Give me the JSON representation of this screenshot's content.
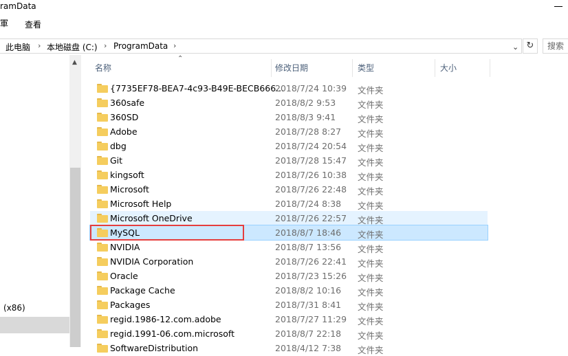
{
  "window": {
    "title": "ramData"
  },
  "ribbon": {
    "edge_label": "軍",
    "view_tab": "查看"
  },
  "address": {
    "crumbs": [
      "此电脑",
      "本地磁盘 (C:)",
      "ProgramData"
    ],
    "separator": "›",
    "dropdown": "⌄",
    "refresh": "↻",
    "search_placeholder": "搜索"
  },
  "nav": {
    "partial_item": "(x86)"
  },
  "columns": {
    "name": "名称",
    "modified": "修改日期",
    "type": "类型",
    "size": "大小",
    "sort_indicator": "⌃"
  },
  "files": [
    {
      "name": "{7735EF78-BEA7-4c93-B49E-BECB666...",
      "date": "2018/7/24 10:39",
      "type": "文件夹"
    },
    {
      "name": "360safe",
      "date": "2018/8/2 9:53",
      "type": "文件夹"
    },
    {
      "name": "360SD",
      "date": "2018/8/3 9:41",
      "type": "文件夹"
    },
    {
      "name": "Adobe",
      "date": "2018/7/28 8:27",
      "type": "文件夹"
    },
    {
      "name": "dbg",
      "date": "2018/7/24 20:54",
      "type": "文件夹"
    },
    {
      "name": "Git",
      "date": "2018/7/28 15:47",
      "type": "文件夹"
    },
    {
      "name": "kingsoft",
      "date": "2018/7/26 10:38",
      "type": "文件夹"
    },
    {
      "name": "Microsoft",
      "date": "2018/7/26 22:48",
      "type": "文件夹"
    },
    {
      "name": "Microsoft Help",
      "date": "2018/7/24 8:38",
      "type": "文件夹"
    },
    {
      "name": "Microsoft OneDrive",
      "date": "2018/7/26 22:57",
      "type": "文件夹"
    },
    {
      "name": "MySQL",
      "date": "2018/8/7 18:46",
      "type": "文件夹"
    },
    {
      "name": "NVIDIA",
      "date": "2018/8/7 13:56",
      "type": "文件夹"
    },
    {
      "name": "NVIDIA Corporation",
      "date": "2018/7/26 22:41",
      "type": "文件夹"
    },
    {
      "name": "Oracle",
      "date": "2018/7/23 15:26",
      "type": "文件夹"
    },
    {
      "name": "Package Cache",
      "date": "2018/8/2 10:16",
      "type": "文件夹"
    },
    {
      "name": "Packages",
      "date": "2018/7/31 8:41",
      "type": "文件夹"
    },
    {
      "name": "regid.1986-12.com.adobe",
      "date": "2018/7/27 11:29",
      "type": "文件夹"
    },
    {
      "name": "regid.1991-06.com.microsoft",
      "date": "2018/8/7 22:18",
      "type": "文件夹"
    },
    {
      "name": "SoftwareDistribution",
      "date": "2018/4/12 7:38",
      "type": "文件夹"
    }
  ],
  "state": {
    "hovered": "Microsoft OneDrive",
    "selected": "MySQL",
    "highlighted": "MySQL"
  },
  "colors": {
    "highlight_border": "#e53d3d",
    "selection": "#cce8ff",
    "hover": "#e5f3ff",
    "folder": "#f5cd5e"
  }
}
